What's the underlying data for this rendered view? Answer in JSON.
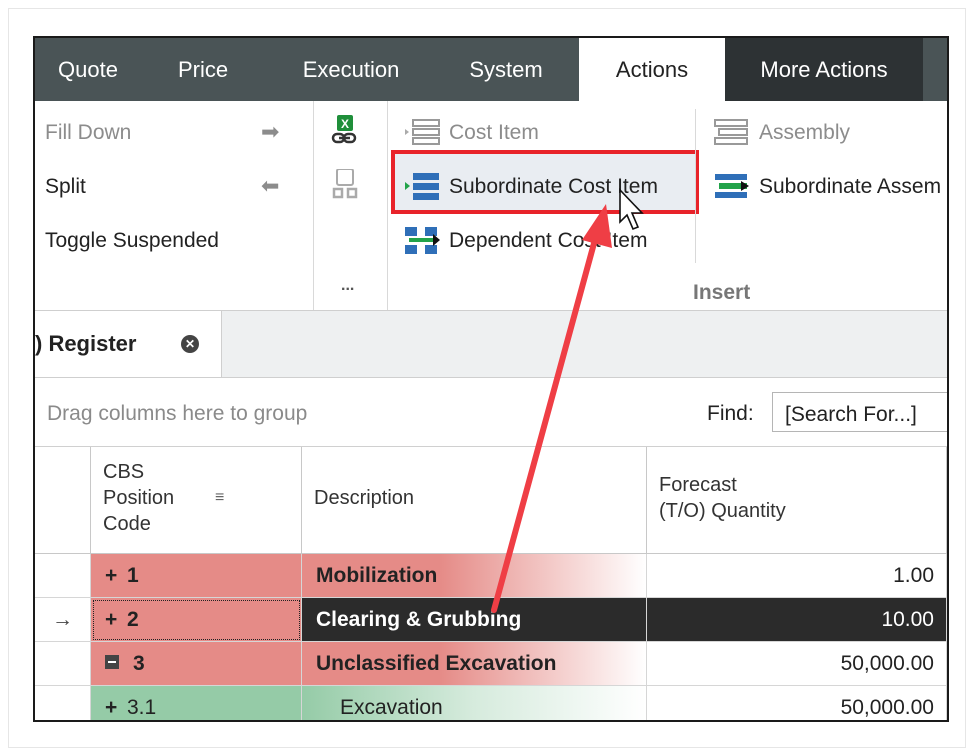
{
  "tabs": [
    {
      "label": "Quote",
      "state": "normal"
    },
    {
      "label": "Price",
      "state": "normal"
    },
    {
      "label": "Execution",
      "state": "normal"
    },
    {
      "label": "System",
      "state": "normal"
    },
    {
      "label": "Actions",
      "state": "active"
    },
    {
      "label": "More Actions",
      "state": "dark"
    }
  ],
  "ribbon": {
    "edit_group": {
      "fill_down": "Fill Down",
      "split": "Split",
      "toggle_suspended": "Toggle Suspended"
    },
    "more_label": "...",
    "insert_group": {
      "label": "Insert",
      "cost_item": "Cost Item",
      "subordinate_cost_item": "Subordinate Cost Item",
      "dependent_cost_item": "Dependent Cost Item",
      "assembly": "Assembly",
      "subordinate_assembly": "Subordinate Assem"
    }
  },
  "doc_tab": {
    "label": ") Register",
    "close": "✕"
  },
  "grid": {
    "group_hint": "Drag columns here to group",
    "find_label": "Find:",
    "find_value": "[Search For...]",
    "columns": {
      "code_line1": "CBS",
      "code_line2": "Position",
      "code_line3": "Code",
      "description": "Description",
      "qty_line1": "Forecast",
      "qty_line2": "(T/O) Quantity"
    },
    "rows": [
      {
        "indicator": "",
        "expander": "+",
        "code": "1",
        "description": "Mobilization",
        "quantity": "1.00"
      },
      {
        "indicator": "→",
        "expander": "+",
        "code": "2",
        "description": "Clearing & Grubbing",
        "quantity": "10.00"
      },
      {
        "indicator": "",
        "expander": "−",
        "code": "3",
        "description": "Unclassified Excavation",
        "quantity": "50,000.00"
      },
      {
        "indicator": "",
        "expander": "+",
        "code": "3.1",
        "description": "Excavation",
        "quantity": "50,000.00"
      }
    ]
  },
  "annotation_color": "#ef3e45",
  "highlight_color": "#e8232a"
}
